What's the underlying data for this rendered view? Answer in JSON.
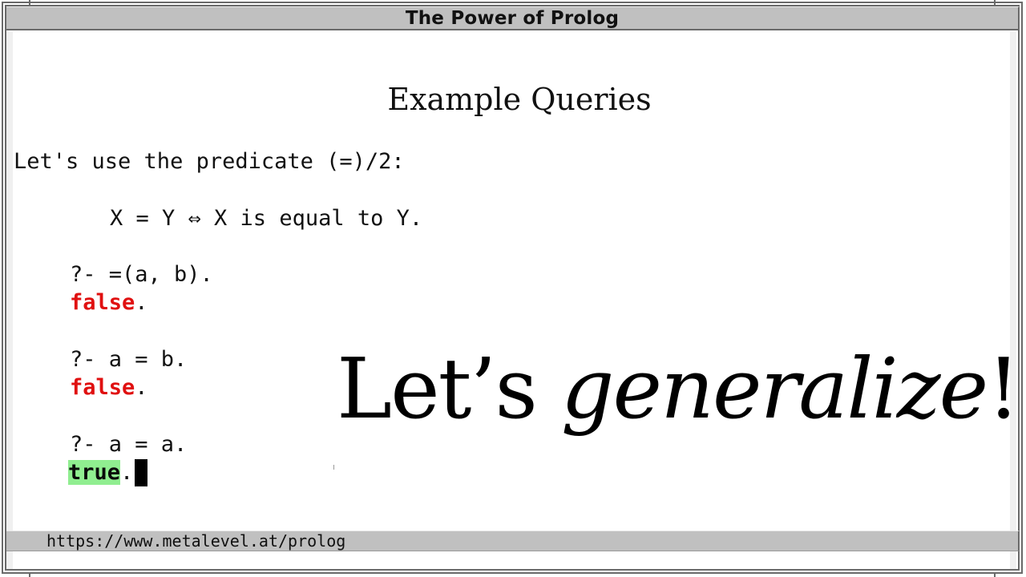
{
  "window": {
    "title": "The Power of Prolog"
  },
  "slide": {
    "heading": "Example Queries",
    "intro": "Let's use the predicate (=)/2:",
    "definition": "X = Y ⇔ X is equal to Y.",
    "queries": [
      {
        "prompt": "?- =(a, b).",
        "answer": "false",
        "answer_status": "false",
        "terminator": "."
      },
      {
        "prompt": "?- a = b.",
        "answer": "false",
        "answer_status": "false",
        "terminator": "."
      },
      {
        "prompt": "?- a = a.",
        "answer": "true",
        "answer_status": "true",
        "terminator": "."
      }
    ],
    "overlay": {
      "plain": "Let’s ",
      "emphasis": "generalize",
      "suffix": "!"
    }
  },
  "status_bar": {
    "url": "https://www.metalevel.at/prolog"
  },
  "colors": {
    "false_answer": "#e01010",
    "true_highlight": "#90ee90",
    "chrome_gray": "#c0c0c0"
  }
}
